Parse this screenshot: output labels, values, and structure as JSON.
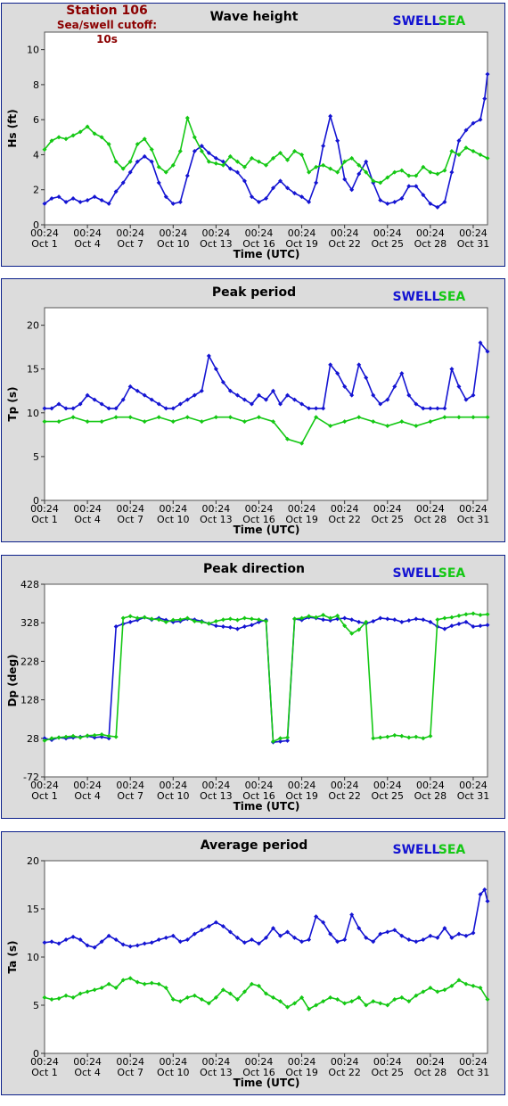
{
  "station": {
    "name": "Station 106",
    "cutoff": "Sea/swell cutoff: 10s"
  },
  "colors": {
    "swell": "#1414d2",
    "sea": "#14c814",
    "plot_bg": "#ffffff",
    "panel_bg": "#dcdcdc",
    "border": "#0b1f8a"
  },
  "x_ticks": [
    {
      "time": "00:24",
      "date": "Oct 1"
    },
    {
      "time": "00:24",
      "date": "Oct 4"
    },
    {
      "time": "00:24",
      "date": "Oct 7"
    },
    {
      "time": "00:24",
      "date": "Oct 10"
    },
    {
      "time": "00:24",
      "date": "Oct 13"
    },
    {
      "time": "00:24",
      "date": "Oct 16"
    },
    {
      "time": "00:24",
      "date": "Oct 19"
    },
    {
      "time": "00:24",
      "date": "Oct 22"
    },
    {
      "time": "00:24",
      "date": "Oct 25"
    },
    {
      "time": "00:24",
      "date": "Oct 28"
    },
    {
      "time": "00:24",
      "date": "Oct 31"
    }
  ],
  "chart_data": [
    {
      "type": "line",
      "title": "Wave height",
      "xlabel": "Time (UTC)",
      "ylabel": "Hs (ft)",
      "x_range": [
        1,
        32
      ],
      "ylim": [
        0,
        11
      ],
      "yticks": [
        0,
        2,
        4,
        6,
        8,
        10
      ],
      "legend": [
        "SWELL",
        "SEA"
      ],
      "legend_position": "top-right",
      "series": [
        {
          "name": "SWELL",
          "color": "#1414d2",
          "x": [
            1,
            1.5,
            2,
            2.5,
            3,
            3.5,
            4,
            4.5,
            5,
            5.5,
            6,
            6.5,
            7,
            7.5,
            8,
            8.5,
            9,
            9.5,
            10,
            10.5,
            11,
            11.5,
            12,
            12.5,
            13,
            13.5,
            14,
            14.5,
            15,
            15.5,
            16,
            16.5,
            17,
            17.5,
            18,
            18.5,
            19,
            19.5,
            20,
            20.5,
            21,
            21.5,
            22,
            22.5,
            23,
            23.5,
            24,
            24.5,
            25,
            25.5,
            26,
            26.5,
            27,
            27.5,
            28,
            28.5,
            29,
            29.5,
            30,
            30.5,
            31,
            31.5,
            31.8,
            32
          ],
          "y": [
            1.2,
            1.5,
            1.6,
            1.3,
            1.5,
            1.3,
            1.4,
            1.6,
            1.4,
            1.2,
            1.9,
            2.4,
            3.0,
            3.6,
            3.9,
            3.6,
            2.4,
            1.6,
            1.2,
            1.3,
            2.8,
            4.2,
            4.5,
            4.1,
            3.8,
            3.6,
            3.2,
            3.0,
            2.5,
            1.6,
            1.3,
            1.5,
            2.1,
            2.5,
            2.1,
            1.8,
            1.6,
            1.3,
            2.4,
            4.5,
            6.2,
            4.8,
            2.6,
            2.0,
            2.9,
            3.6,
            2.4,
            1.4,
            1.2,
            1.3,
            1.5,
            2.2,
            2.2,
            1.7,
            1.2,
            1.0,
            1.3,
            3.0,
            4.8,
            5.4,
            5.8,
            6.0,
            7.2,
            8.6
          ]
        },
        {
          "name": "SEA",
          "color": "#14c814",
          "x": [
            1,
            1.5,
            2,
            2.5,
            3,
            3.5,
            4,
            4.5,
            5,
            5.5,
            6,
            6.5,
            7,
            7.5,
            8,
            8.5,
            9,
            9.5,
            10,
            10.5,
            11,
            11.5,
            12,
            12.5,
            13,
            13.5,
            14,
            14.5,
            15,
            15.5,
            16,
            16.5,
            17,
            17.5,
            18,
            18.5,
            19,
            19.5,
            20,
            20.5,
            21,
            21.5,
            22,
            22.5,
            23,
            23.5,
            24,
            24.5,
            25,
            25.5,
            26,
            26.5,
            27,
            27.5,
            28,
            28.5,
            29,
            29.5,
            30,
            30.5,
            31,
            31.5,
            32
          ],
          "y": [
            4.3,
            4.8,
            5.0,
            4.9,
            5.1,
            5.3,
            5.6,
            5.2,
            5.0,
            4.6,
            3.6,
            3.2,
            3.6,
            4.6,
            4.9,
            4.3,
            3.3,
            3.0,
            3.4,
            4.2,
            6.1,
            5.0,
            4.2,
            3.6,
            3.5,
            3.4,
            3.9,
            3.6,
            3.3,
            3.8,
            3.6,
            3.4,
            3.8,
            4.1,
            3.7,
            4.2,
            4.0,
            3.0,
            3.3,
            3.4,
            3.2,
            3.0,
            3.6,
            3.8,
            3.4,
            3.0,
            2.5,
            2.4,
            2.7,
            3.0,
            3.1,
            2.8,
            2.8,
            3.3,
            3.0,
            2.9,
            3.1,
            4.2,
            4.0,
            4.4,
            4.2,
            4.0,
            3.8
          ]
        }
      ]
    },
    {
      "type": "line",
      "title": "Peak period",
      "xlabel": "Time (UTC)",
      "ylabel": "Tp (s)",
      "x_range": [
        1,
        32
      ],
      "ylim": [
        0,
        22
      ],
      "yticks": [
        0,
        5,
        10,
        15,
        20
      ],
      "legend": [
        "SWELL",
        "SEA"
      ],
      "legend_position": "top-right",
      "series": [
        {
          "name": "SWELL",
          "color": "#1414d2",
          "x": [
            1,
            1.5,
            2,
            2.5,
            3,
            3.5,
            4,
            4.5,
            5,
            5.5,
            6,
            6.5,
            7,
            7.5,
            8,
            8.5,
            9,
            9.5,
            10,
            10.5,
            11,
            11.5,
            12,
            12.5,
            13,
            13.5,
            14,
            14.5,
            15,
            15.5,
            16,
            16.5,
            17,
            17.5,
            18,
            18.5,
            19,
            19.5,
            20,
            20.5,
            21,
            21.5,
            22,
            22.5,
            23,
            23.5,
            24,
            24.5,
            25,
            25.5,
            26,
            26.5,
            27,
            27.5,
            28,
            28.5,
            29,
            29.5,
            30,
            30.5,
            31,
            31.5,
            32
          ],
          "y": [
            10.5,
            10.5,
            11.0,
            10.5,
            10.5,
            11.0,
            12.0,
            11.5,
            11.0,
            10.5,
            10.5,
            11.5,
            13.0,
            12.5,
            12.0,
            11.5,
            11.0,
            10.5,
            10.5,
            11.0,
            11.5,
            12.0,
            12.5,
            16.5,
            15.0,
            13.5,
            12.5,
            12.0,
            11.5,
            11.0,
            12.0,
            11.5,
            12.5,
            11.0,
            12.0,
            11.5,
            11.0,
            10.5,
            10.5,
            10.5,
            15.5,
            14.5,
            13.0,
            12.0,
            15.5,
            14.0,
            12.0,
            11.0,
            11.5,
            13.0,
            14.5,
            12.0,
            11.0,
            10.5,
            10.5,
            10.5,
            10.5,
            15.0,
            13.0,
            11.5,
            12.0,
            18.0,
            17.0
          ]
        },
        {
          "name": "SEA",
          "color": "#14c814",
          "x": [
            1,
            2,
            3,
            4,
            5,
            6,
            7,
            8,
            9,
            10,
            11,
            12,
            13,
            14,
            15,
            16,
            17,
            18,
            19,
            20,
            21,
            22,
            23,
            24,
            25,
            26,
            27,
            28,
            29,
            30,
            31,
            32
          ],
          "y": [
            9.0,
            9.0,
            9.5,
            9.0,
            9.0,
            9.5,
            9.5,
            9.0,
            9.5,
            9.0,
            9.5,
            9.0,
            9.5,
            9.5,
            9.0,
            9.5,
            9.0,
            7.0,
            6.5,
            9.5,
            8.5,
            9.0,
            9.5,
            9.0,
            8.5,
            9.0,
            8.5,
            9.0,
            9.5,
            9.5,
            9.5,
            9.5
          ]
        }
      ]
    },
    {
      "type": "line",
      "title": "Peak direction",
      "xlabel": "Time (UTC)",
      "ylabel": "Dp (deg)",
      "x_range": [
        1,
        32
      ],
      "ylim": [
        -72,
        428
      ],
      "yticks": [
        -72,
        28,
        128,
        228,
        328,
        428
      ],
      "legend": [
        "SWELL",
        "SEA"
      ],
      "legend_position": "top-right",
      "series": [
        {
          "name": "SWELL",
          "color": "#1414d2",
          "x": [
            1,
            1.5,
            2,
            2.5,
            3,
            3.5,
            4,
            4.5,
            5,
            5.5,
            6,
            6.5,
            7,
            7.5,
            8,
            8.5,
            9,
            9.5,
            10,
            10.5,
            11,
            11.5,
            12,
            12.5,
            13,
            13.5,
            14,
            14.5,
            15,
            15.5,
            16,
            16.5,
            17,
            17.5,
            18,
            18.5,
            19,
            19.5,
            20,
            20.5,
            21,
            21.5,
            22,
            22.5,
            23,
            23.5,
            24,
            24.5,
            25,
            25.5,
            26,
            26.5,
            27,
            27.5,
            28,
            28.5,
            29,
            29.5,
            30,
            30.5,
            31,
            31.5,
            32
          ],
          "y": [
            28,
            24,
            30,
            28,
            30,
            32,
            34,
            30,
            32,
            28,
            318,
            325,
            330,
            335,
            342,
            336,
            340,
            335,
            330,
            332,
            338,
            336,
            332,
            326,
            320,
            318,
            316,
            312,
            318,
            322,
            330,
            335,
            18,
            20,
            22,
            338,
            335,
            342,
            340,
            336,
            334,
            338,
            340,
            336,
            330,
            326,
            332,
            340,
            338,
            336,
            330,
            334,
            338,
            336,
            330,
            318,
            312,
            320,
            325,
            330,
            318,
            320,
            322
          ]
        },
        {
          "name": "SEA",
          "color": "#14c814",
          "x": [
            1,
            1.5,
            2,
            2.5,
            3,
            3.5,
            4,
            4.5,
            5,
            5.5,
            6,
            6.5,
            7,
            7.5,
            8,
            8.5,
            9,
            9.5,
            10,
            10.5,
            11,
            11.5,
            12,
            12.5,
            13,
            13.5,
            14,
            14.5,
            15,
            15.5,
            16,
            16.5,
            17,
            17.5,
            18,
            18.5,
            19,
            19.5,
            20,
            20.5,
            21,
            21.5,
            22,
            22.5,
            23,
            23.5,
            24,
            24.5,
            25,
            25.5,
            26,
            26.5,
            27,
            27.5,
            28,
            28.5,
            29,
            29.5,
            30,
            30.5,
            31,
            31.5,
            32
          ],
          "y": [
            22,
            28,
            30,
            32,
            34,
            30,
            35,
            36,
            38,
            34,
            32,
            340,
            345,
            340,
            342,
            338,
            336,
            330,
            335,
            336,
            340,
            332,
            330,
            326,
            332,
            336,
            338,
            335,
            340,
            338,
            336,
            332,
            20,
            28,
            30,
            338,
            340,
            345,
            342,
            348,
            340,
            346,
            320,
            300,
            310,
            330,
            28,
            30,
            32,
            36,
            34,
            30,
            32,
            28,
            34,
            336,
            340,
            342,
            346,
            350,
            352,
            348,
            350
          ]
        }
      ]
    },
    {
      "type": "line",
      "title": "Average period",
      "xlabel": "Time (UTC)",
      "ylabel": "Ta (s)",
      "x_range": [
        1,
        32
      ],
      "ylim": [
        0,
        20
      ],
      "yticks": [
        0,
        5,
        10,
        15,
        20
      ],
      "legend": [
        "SWELL",
        "SEA"
      ],
      "legend_position": "top-right",
      "series": [
        {
          "name": "SWELL",
          "color": "#1414d2",
          "x": [
            1,
            1.5,
            2,
            2.5,
            3,
            3.5,
            4,
            4.5,
            5,
            5.5,
            6,
            6.5,
            7,
            7.5,
            8,
            8.5,
            9,
            9.5,
            10,
            10.5,
            11,
            11.5,
            12,
            12.5,
            13,
            13.5,
            14,
            14.5,
            15,
            15.5,
            16,
            16.5,
            17,
            17.5,
            18,
            18.5,
            19,
            19.5,
            20,
            20.5,
            21,
            21.5,
            22,
            22.5,
            23,
            23.5,
            24,
            24.5,
            25,
            25.5,
            26,
            26.5,
            27,
            27.5,
            28,
            28.5,
            29,
            29.5,
            30,
            30.5,
            31,
            31.5,
            31.8,
            32
          ],
          "y": [
            11.5,
            11.6,
            11.4,
            11.8,
            12.1,
            11.8,
            11.2,
            11.0,
            11.6,
            12.2,
            11.8,
            11.3,
            11.1,
            11.2,
            11.4,
            11.5,
            11.8,
            12.0,
            12.2,
            11.6,
            11.8,
            12.4,
            12.8,
            13.2,
            13.6,
            13.2,
            12.6,
            12.0,
            11.5,
            11.8,
            11.4,
            12.0,
            13.0,
            12.2,
            12.6,
            12.0,
            11.6,
            11.8,
            14.2,
            13.6,
            12.4,
            11.6,
            11.8,
            14.4,
            13.0,
            12.0,
            11.6,
            12.4,
            12.6,
            12.8,
            12.2,
            11.8,
            11.6,
            11.8,
            12.2,
            12.0,
            13.0,
            12.0,
            12.4,
            12.2,
            12.5,
            16.5,
            17.0,
            15.8
          ]
        },
        {
          "name": "SEA",
          "color": "#14c814",
          "x": [
            1,
            1.5,
            2,
            2.5,
            3,
            3.5,
            4,
            4.5,
            5,
            5.5,
            6,
            6.5,
            7,
            7.5,
            8,
            8.5,
            9,
            9.5,
            10,
            10.5,
            11,
            11.5,
            12,
            12.5,
            13,
            13.5,
            14,
            14.5,
            15,
            15.5,
            16,
            16.5,
            17,
            17.5,
            18,
            18.5,
            19,
            19.5,
            20,
            20.5,
            21,
            21.5,
            22,
            22.5,
            23,
            23.5,
            24,
            24.5,
            25,
            25.5,
            26,
            26.5,
            27,
            27.5,
            28,
            28.5,
            29,
            29.5,
            30,
            30.5,
            31,
            31.5,
            32
          ],
          "y": [
            5.8,
            5.6,
            5.7,
            6.0,
            5.8,
            6.2,
            6.4,
            6.6,
            6.8,
            7.2,
            6.8,
            7.6,
            7.8,
            7.4,
            7.2,
            7.3,
            7.2,
            6.8,
            5.6,
            5.4,
            5.8,
            6.0,
            5.6,
            5.2,
            5.8,
            6.6,
            6.2,
            5.6,
            6.4,
            7.2,
            7.0,
            6.2,
            5.8,
            5.4,
            4.8,
            5.2,
            5.8,
            4.6,
            5.0,
            5.4,
            5.8,
            5.6,
            5.2,
            5.4,
            5.8,
            5.0,
            5.4,
            5.2,
            5.0,
            5.6,
            5.8,
            5.4,
            6.0,
            6.4,
            6.8,
            6.4,
            6.6,
            7.0,
            7.6,
            7.2,
            7.0,
            6.8,
            5.6
          ]
        }
      ]
    }
  ]
}
